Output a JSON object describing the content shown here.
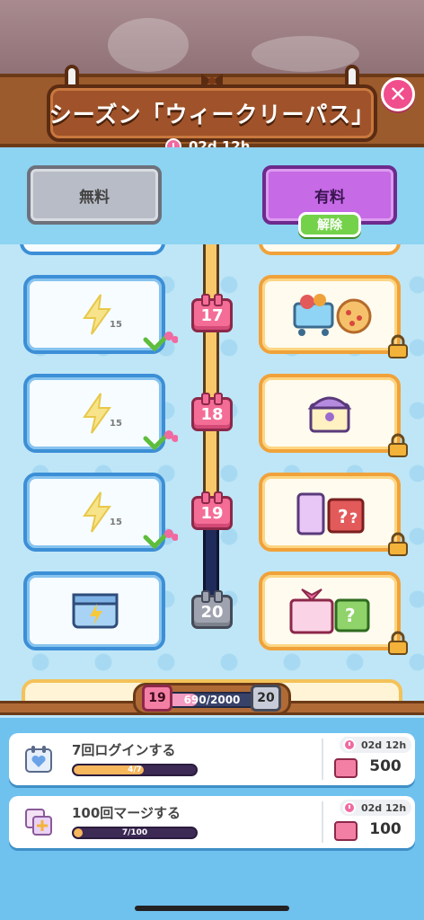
{
  "header": {
    "title": "シーズン「ウィークリーパス」",
    "timer": "02d 12h"
  },
  "tiers": {
    "free_label": "無料",
    "paid_label": "有料",
    "unlock_label": "解除"
  },
  "levels": [
    {
      "number": "17",
      "free_reward": "bolt",
      "free_count": "15",
      "claimed": true,
      "paid_reward": "cart-and-pizza"
    },
    {
      "number": "18",
      "free_reward": "bolt",
      "free_count": "15",
      "claimed": true,
      "paid_reward": "treasure-chest"
    },
    {
      "number": "19",
      "free_reward": "bolt",
      "free_count": "15",
      "claimed": true,
      "paid_reward": "mystery-boxes"
    },
    {
      "number": "20",
      "free_reward": "blue-crate",
      "claimed": false,
      "paid_reward": "gift-boxes"
    }
  ],
  "progress": {
    "current_level": "19",
    "next_level": "20",
    "text": "690/2000",
    "fraction": 0.345
  },
  "tasks": [
    {
      "title": "7回ログインする",
      "progress_text": "4/7",
      "fraction": 0.571,
      "timer": "02d 12h",
      "reward": "500",
      "icon": "heart-calendar-icon"
    },
    {
      "title": "100回マージする",
      "progress_text": "7/100",
      "fraction": 0.07,
      "timer": "02d 12h",
      "reward": "100",
      "icon": "merge-plus-icon"
    }
  ],
  "colors": {
    "accent_pink": "#f46d97",
    "wood": "#a0532a",
    "paid_purple": "#c66ae6",
    "free_gray": "#b8bcc6",
    "unlock_green": "#74d24a"
  }
}
